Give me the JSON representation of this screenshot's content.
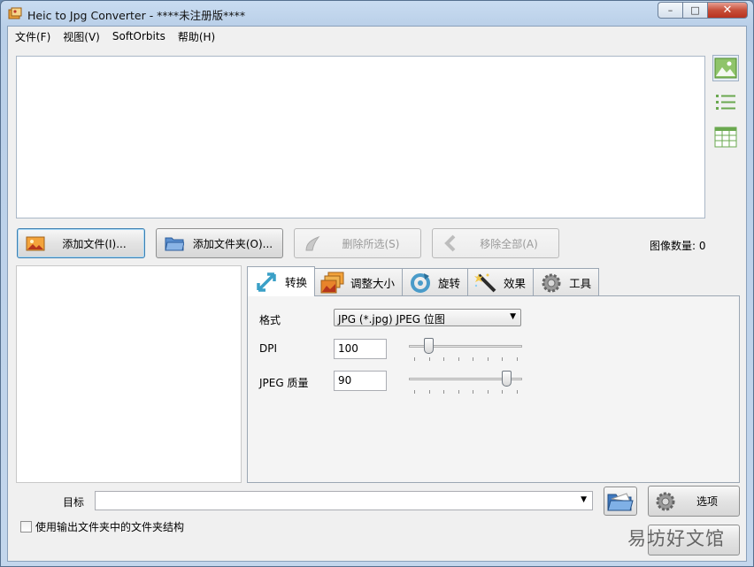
{
  "window": {
    "title": "Heic to Jpg Converter - ****未注册版****",
    "controls": {
      "minimize": "–",
      "maximize": "□",
      "close": "✕"
    }
  },
  "menubar": {
    "items": [
      {
        "label": "文件(F)"
      },
      {
        "label": "视图(V)"
      },
      {
        "label": "SoftOrbits"
      },
      {
        "label": "帮助(H)"
      }
    ]
  },
  "toolbar": {
    "add_files": "添加文件(I)...",
    "add_folder": "添加文件夹(O)...",
    "remove_selected": "删除所选(S)",
    "remove_all": "移除全部(A)",
    "image_count": "图像数量: 0"
  },
  "view_icons": [
    "image-view-icon",
    "list-view-icon",
    "grid-view-icon"
  ],
  "tabs": [
    {
      "label": "转换",
      "icon": "convert-arrows-icon",
      "active": true
    },
    {
      "label": "调整大小",
      "icon": "resize-images-icon",
      "active": false
    },
    {
      "label": "旋转",
      "icon": "rotate-icon",
      "active": false
    },
    {
      "label": "效果",
      "icon": "magic-wand-icon",
      "active": false
    },
    {
      "label": "工具",
      "icon": "gear-icon",
      "active": false
    }
  ],
  "convert": {
    "format_label": "格式",
    "format_value": "JPG (*.jpg) JPEG 位图",
    "dpi_label": "DPI",
    "dpi_value": "100",
    "dpi_slider_fraction": 0.14,
    "quality_label": "JPEG 质量",
    "quality_value": "90",
    "quality_slider_fraction": 0.9
  },
  "output": {
    "target_label": "目标",
    "target_value": "",
    "options_label": "选项",
    "keep_structure_label": "使用输出文件夹中的文件夹结构",
    "keep_structure_checked": false
  },
  "watermark": "易坊好文馆",
  "colors": {
    "accent_green": "#6aa84f",
    "close_red": "#c74f3a",
    "focus_blue": "#3c7fb1"
  }
}
